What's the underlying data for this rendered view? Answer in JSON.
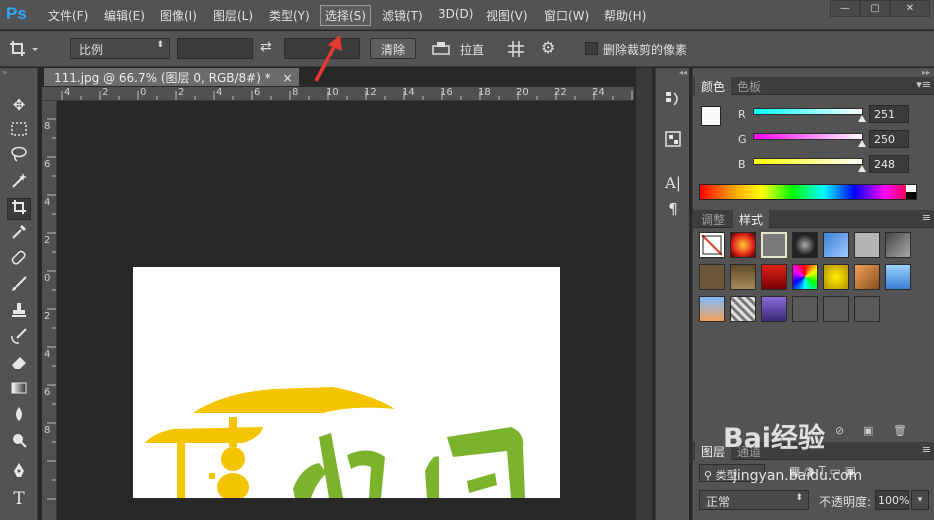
{
  "menubar": {
    "logo": "Ps",
    "items": [
      "文件(F)",
      "编辑(E)",
      "图像(I)",
      "图层(L)",
      "类型(Y)",
      "选择(S)",
      "滤镜(T)",
      "3D(D)",
      "视图(V)",
      "窗口(W)",
      "帮助(H)"
    ],
    "active_index": 5,
    "window_buttons": [
      "—",
      "▢",
      "✕"
    ]
  },
  "options": {
    "ratio_select": "比例",
    "swap_icon": "⇄",
    "clear_button": "清除",
    "straighten_label": "拉直",
    "delete_cropped_label": "删除裁剪的像素"
  },
  "document": {
    "tab_title": "111.jpg @ 66.7% (图层 0, RGB/8#) *",
    "close_glyph": "×",
    "ruler_top": [
      "4",
      "2",
      "0",
      "2",
      "4",
      "6",
      "8",
      "10",
      "12",
      "14",
      "16",
      "18",
      "20",
      "22",
      "24"
    ],
    "ruler_left": [
      "8",
      "6",
      "4",
      "2",
      "0",
      "2",
      "4",
      "6",
      "8"
    ]
  },
  "tools": [
    "move-icon",
    "marquee-icon",
    "lasso-icon",
    "magic-wand-icon",
    "crop-icon",
    "eyedropper-icon",
    "healing-icon",
    "brush-icon",
    "stamp-icon",
    "history-brush-icon",
    "eraser-icon",
    "gradient-icon",
    "blur-icon",
    "dodge-icon",
    "pen-icon",
    "type-icon"
  ],
  "color_panel": {
    "tabs": [
      "颜色",
      "色板"
    ],
    "active_tab": 0,
    "channels": [
      {
        "label": "R",
        "value": "251"
      },
      {
        "label": "G",
        "value": "250"
      },
      {
        "label": "B",
        "value": "248"
      }
    ]
  },
  "styles_panel": {
    "tabs": [
      "调整",
      "样式"
    ],
    "active_tab": 1
  },
  "layers_panel": {
    "tabs": [
      "图层",
      "通道"
    ],
    "kind_label": "类型",
    "blend_mode": "正常",
    "opacity_label": "不透明度:",
    "opacity_value": "100%"
  },
  "watermark": {
    "logo": "Bai经验",
    "url": "jingyan.baidu.com"
  },
  "colors": {
    "app_bg": "#535353",
    "canvas_bg": "#282828",
    "logo_yellow": "#f5c400",
    "logo_green": "#7cb32c"
  }
}
